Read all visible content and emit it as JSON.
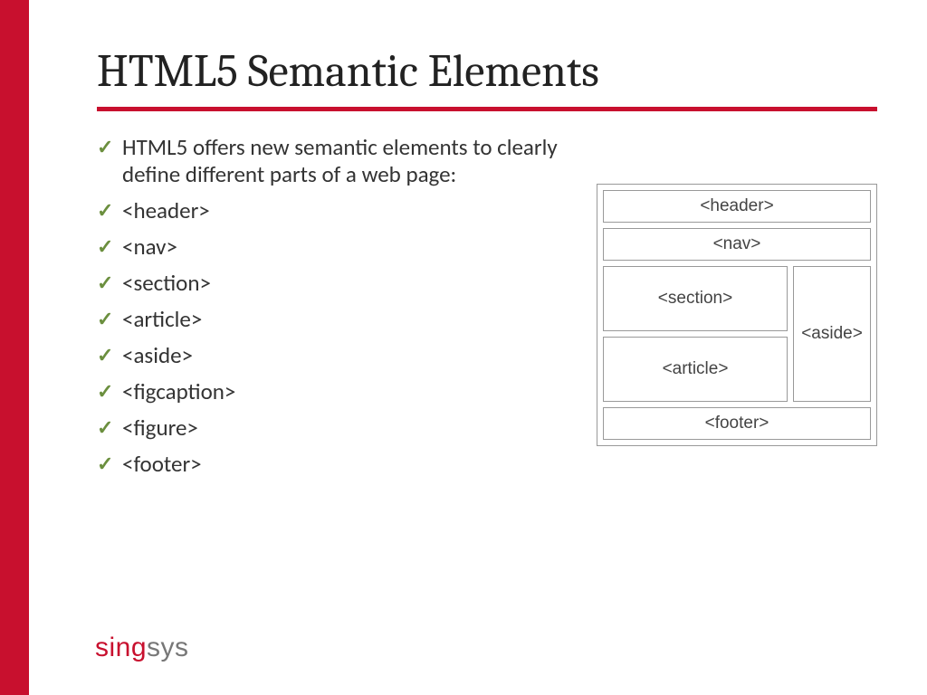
{
  "title": "HTML5 Semantic Elements",
  "bullets": [
    "HTML5 offers new semantic elements to clearly define different parts of a web page:",
    "<header>",
    "<nav>",
    "<section>",
    "<article>",
    "<aside>",
    "<figcaption>",
    "<figure>",
    "<footer>"
  ],
  "diagram": {
    "header": "<header>",
    "nav": "<nav>",
    "section": "<section>",
    "article": "<article>",
    "aside": "<aside>",
    "footer": "<footer>"
  },
  "logo": {
    "part1": "sing",
    "part2": "sys"
  },
  "colors": {
    "accent": "#c8102e",
    "check": "#6b8f3e"
  }
}
